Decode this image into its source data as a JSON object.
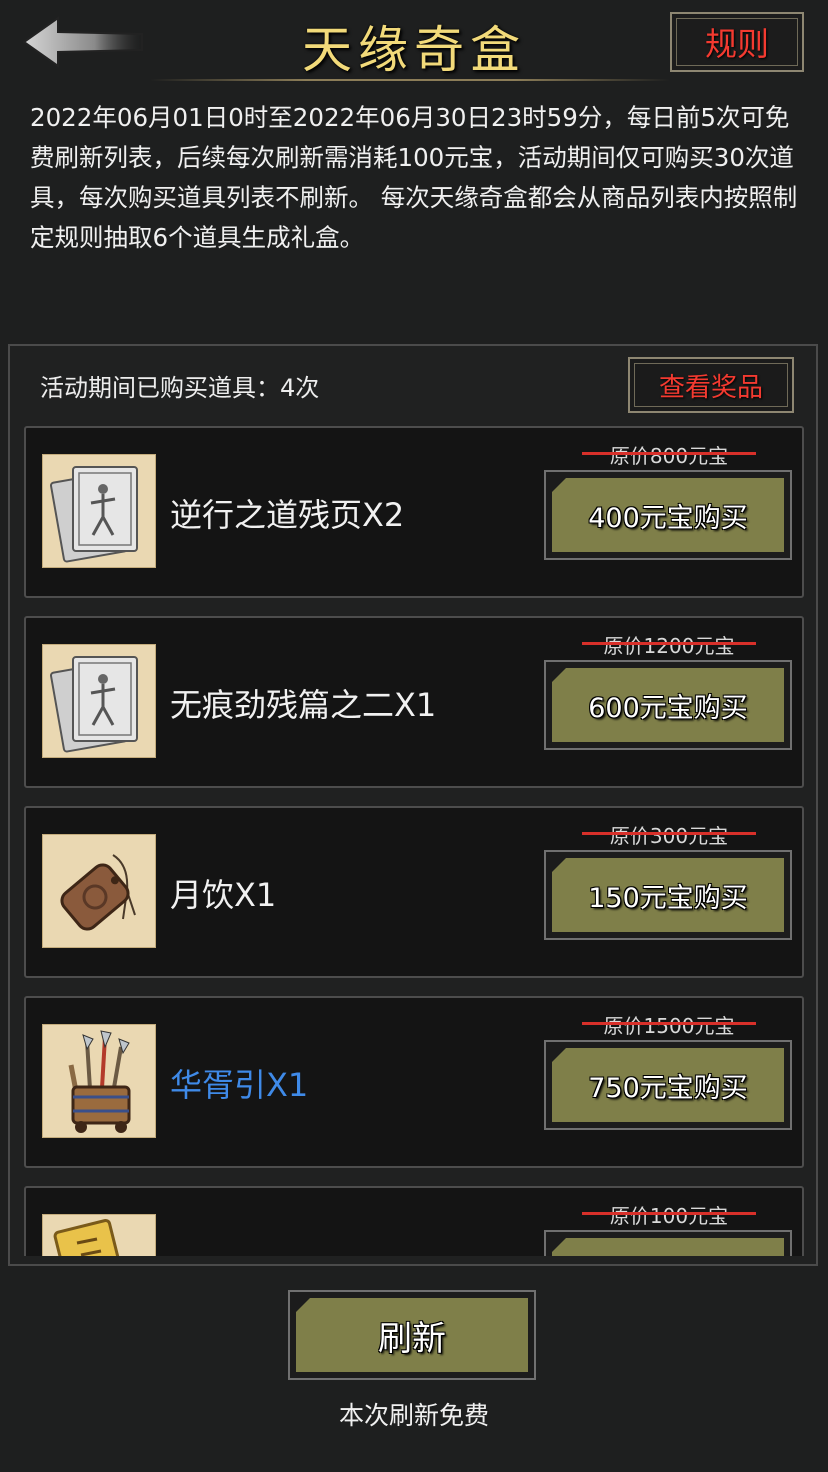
{
  "header": {
    "title": "天缘奇盒",
    "rules_label": "规则"
  },
  "description": "2022年06月01日0时至2022年06月30日23时59分，每日前5次可免费刷新列表，后续每次刷新需消耗100元宝，活动期间仅可购买30次道具，每次购买道具列表不刷新。 每次天缘奇盒都会从商品列表内按照制定规则抽取6个道具生成礼盒。",
  "panel": {
    "purchased_text": "活动期间已购买道具：4次",
    "view_prizes_label": "查看奖品"
  },
  "items": [
    {
      "name": "逆行之道残页X2",
      "original_price": "原价800元宝",
      "buy_label": "400元宝购买",
      "icon": "scroll-pages-icon",
      "name_color": "#f1f1f1"
    },
    {
      "name": "无痕劲残篇之二X1",
      "original_price": "原价1200元宝",
      "buy_label": "600元宝购买",
      "icon": "scroll-pages-icon",
      "name_color": "#f1f1f1"
    },
    {
      "name": "月饮X1",
      "original_price": "原价300元宝",
      "buy_label": "150元宝购买",
      "icon": "wooden-token-icon",
      "name_color": "#f1f1f1"
    },
    {
      "name": "华胥引X1",
      "original_price": "原价1500元宝",
      "buy_label": "750元宝购买",
      "icon": "weapon-rack-icon",
      "name_color": "#3f8ae8"
    },
    {
      "name": "",
      "original_price": "原价100元宝",
      "buy_label": "",
      "icon": "seal-talisman-icon",
      "name_color": "#f1f1f1"
    }
  ],
  "footer": {
    "refresh_label": "刷新",
    "refresh_note": "本次刷新免费"
  }
}
